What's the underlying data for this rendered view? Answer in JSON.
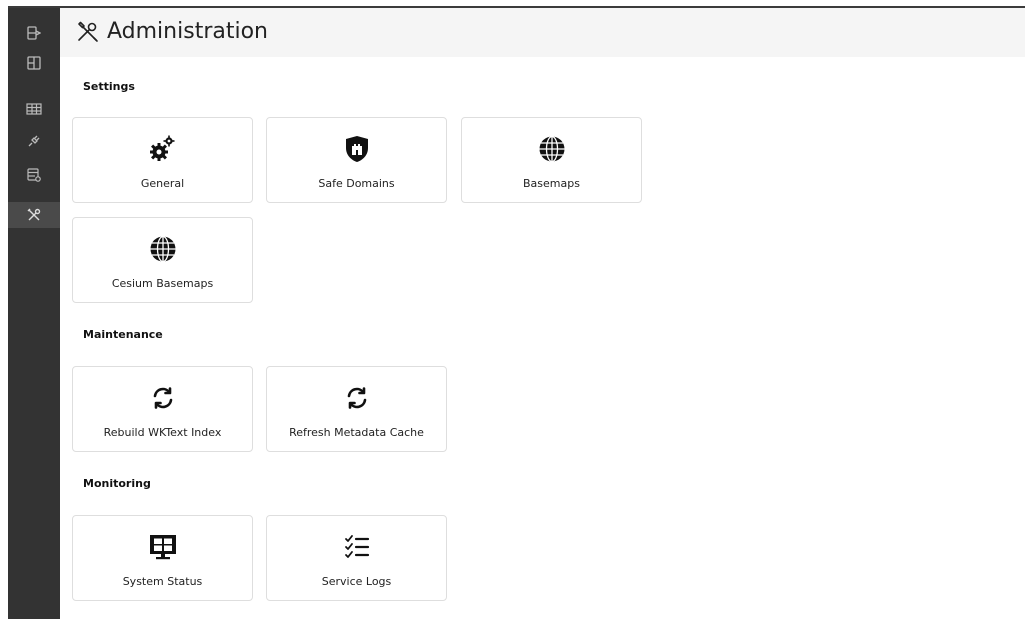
{
  "header": {
    "title": "Administration",
    "title_icon": "tools-icon"
  },
  "sidebar": {
    "items": [
      {
        "icon": "sign-in-icon",
        "active": false
      },
      {
        "icon": "dashboard-icon",
        "active": false
      },
      {
        "icon": "table-icon",
        "active": false
      },
      {
        "icon": "plug-icon",
        "active": false
      },
      {
        "icon": "database-settings-icon",
        "active": false
      },
      {
        "icon": "tools-icon",
        "active": true
      }
    ]
  },
  "sections": {
    "settings": {
      "heading": "Settings",
      "cards": [
        {
          "label": "General",
          "icon": "gears-icon"
        },
        {
          "label": "Safe Domains",
          "icon": "shield-castle-icon"
        },
        {
          "label": "Basemaps",
          "icon": "globe-icon"
        },
        {
          "label": "Cesium Basemaps",
          "icon": "globe-icon"
        }
      ]
    },
    "maintenance": {
      "heading": "Maintenance",
      "cards": [
        {
          "label": "Rebuild WKText Index",
          "icon": "refresh-icon"
        },
        {
          "label": "Refresh Metadata Cache",
          "icon": "refresh-icon"
        }
      ]
    },
    "monitoring": {
      "heading": "Monitoring",
      "cards": [
        {
          "label": "System Status",
          "icon": "monitor-icon"
        },
        {
          "label": "Service Logs",
          "icon": "checklist-icon"
        }
      ]
    }
  },
  "colors": {
    "sidebar_bg": "#333333",
    "sidebar_active": "#4a4a4a",
    "sidebar_icon": "#bbbbbb",
    "topbar_bg": "#f5f5f5",
    "card_border": "#dedede",
    "icon_color": "#111111"
  }
}
